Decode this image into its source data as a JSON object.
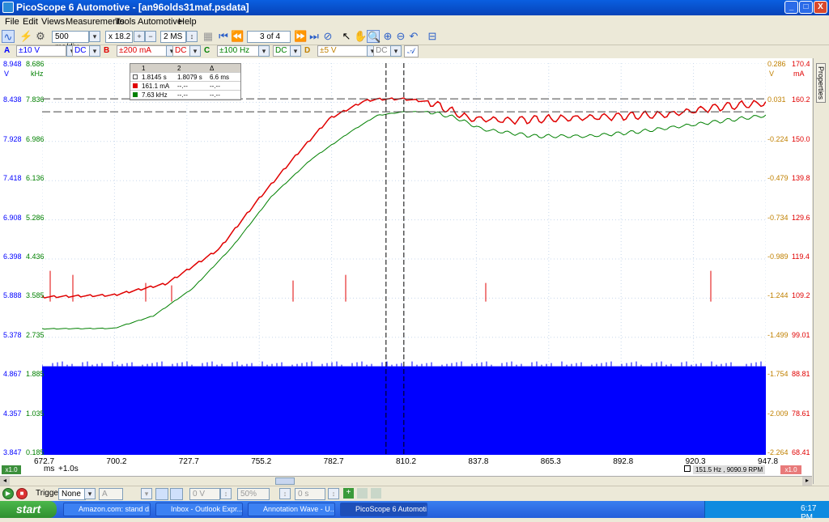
{
  "window": {
    "title": "PicoScope 6 Automotive - [an96olds31maf.psdata]",
    "minimize": "_",
    "maximize": "□",
    "close": "X"
  },
  "menu": [
    "File",
    "Edit",
    "Views",
    "Measurements",
    "Tools",
    "Automotive",
    "Help"
  ],
  "toolbar": {
    "timebase": "500 ms/div",
    "zoom": "x 18.2",
    "samples": "2 MS",
    "buffer": "3 of 4"
  },
  "channels": [
    {
      "letter": "A",
      "range": "±10 V",
      "coupling": "DC",
      "color": "#0000ff"
    },
    {
      "letter": "B",
      "range": "±200 mA",
      "coupling": "DC",
      "color": "#e00000"
    },
    {
      "letter": "C",
      "range": "±100 Hz",
      "coupling": "DC",
      "color": "#008000"
    },
    {
      "letter": "D",
      "range": "±5 V",
      "coupling": "DC",
      "color": "#c08000"
    }
  ],
  "axes": {
    "left1_unit": "V",
    "left2_unit": "kHz",
    "right1_unit": "V",
    "right2_unit": "mA",
    "left1_ticks": [
      "8.948",
      "8.438",
      "7.928",
      "7.418",
      "6.908",
      "6.398",
      "5.888",
      "5.378",
      "4.867",
      "4.357",
      "3.847"
    ],
    "left2_ticks": [
      "8.686",
      "7.836",
      "6.986",
      "6.136",
      "5.286",
      "4.436",
      "3.585",
      "2.735",
      "1.885",
      "1.035",
      "0.185"
    ],
    "right1_ticks": [
      "0.286",
      "0.031",
      "-0.224",
      "-0.479",
      "-0.734",
      "-0.989",
      "-1.244",
      "-1.499",
      "-1.754",
      "-2.009",
      "-2.264"
    ],
    "right2_ticks": [
      "170.4",
      "160.2",
      "150.0",
      "139.8",
      "129.6",
      "119.4",
      "109.2",
      "99.01",
      "88.81",
      "78.61",
      "68.41"
    ],
    "x_ticks": [
      "672.7",
      "700.2",
      "727.7",
      "755.2",
      "782.7",
      "810.2",
      "837.8",
      "865.3",
      "892.8",
      "920.3",
      "947.8"
    ],
    "x_unit": "ms",
    "x_offset": "+1.0s",
    "x_scale_label": "x1.0",
    "right_scale_label": "x1.0"
  },
  "measurements": {
    "headers": [
      "",
      "1",
      "2",
      "Δ"
    ],
    "rows": [
      {
        "color": "#ffffff",
        "c1": "1.8145 s",
        "c2": "1.8079 s",
        "delta": "6.6 ms"
      },
      {
        "color": "#e00000",
        "c1": "161.1 mA",
        "c2": "--.--",
        "delta": "--.--"
      },
      {
        "color": "#008000",
        "c1": "7.63 kHz",
        "c2": "--.--",
        "delta": "--.--"
      }
    ]
  },
  "status_readout": "151.5 Hz , 9090.9 RPM",
  "side_panel": "Properties",
  "trigger": {
    "label": "Trigger",
    "mode": "None",
    "channel": "A",
    "level": "0 V",
    "percent": "50%",
    "delay": "0 s"
  },
  "taskbar": {
    "start": "start",
    "tasks": [
      "Amazon.com: stand d...",
      "Inbox - Outlook Expr...",
      "Annotation Wave - U...",
      "PicoScope 6 Automoti..."
    ],
    "clock": "6:17 PM"
  },
  "chart_data": {
    "type": "line",
    "x_range": [
      672.7,
      947.8
    ],
    "series": [
      {
        "name": "B",
        "color": "#e00000",
        "unit": "mA",
        "x": [
          672.7,
          700,
          720,
          740,
          755,
          770,
          782,
          795,
          800,
          810,
          820,
          835,
          850,
          870,
          890,
          910,
          930,
          947.8
        ],
        "y": [
          109.5,
          110.0,
          113.0,
          122.0,
          135.0,
          147.0,
          156.0,
          160.5,
          161.0,
          161.1,
          160.3,
          156.0,
          155.5,
          156.0,
          156.5,
          157.0,
          159.0,
          160.0
        ]
      },
      {
        "name": "C",
        "color": "#008000",
        "unit": "kHz",
        "x": [
          672.7,
          700,
          715,
          730,
          745,
          760,
          775,
          790,
          800,
          810,
          820,
          830,
          840,
          860,
          880,
          900,
          920,
          947.8
        ],
        "y": [
          2.92,
          2.93,
          3.2,
          3.8,
          4.7,
          5.8,
          6.6,
          7.2,
          7.55,
          7.63,
          7.63,
          7.5,
          7.25,
          7.1,
          7.1,
          7.2,
          7.35,
          7.55
        ]
      },
      {
        "name": "A",
        "color": "#0000ff",
        "unit": "V",
        "x": [
          672.7,
          947.8
        ],
        "y": [
          5.0,
          5.0
        ]
      }
    ]
  }
}
